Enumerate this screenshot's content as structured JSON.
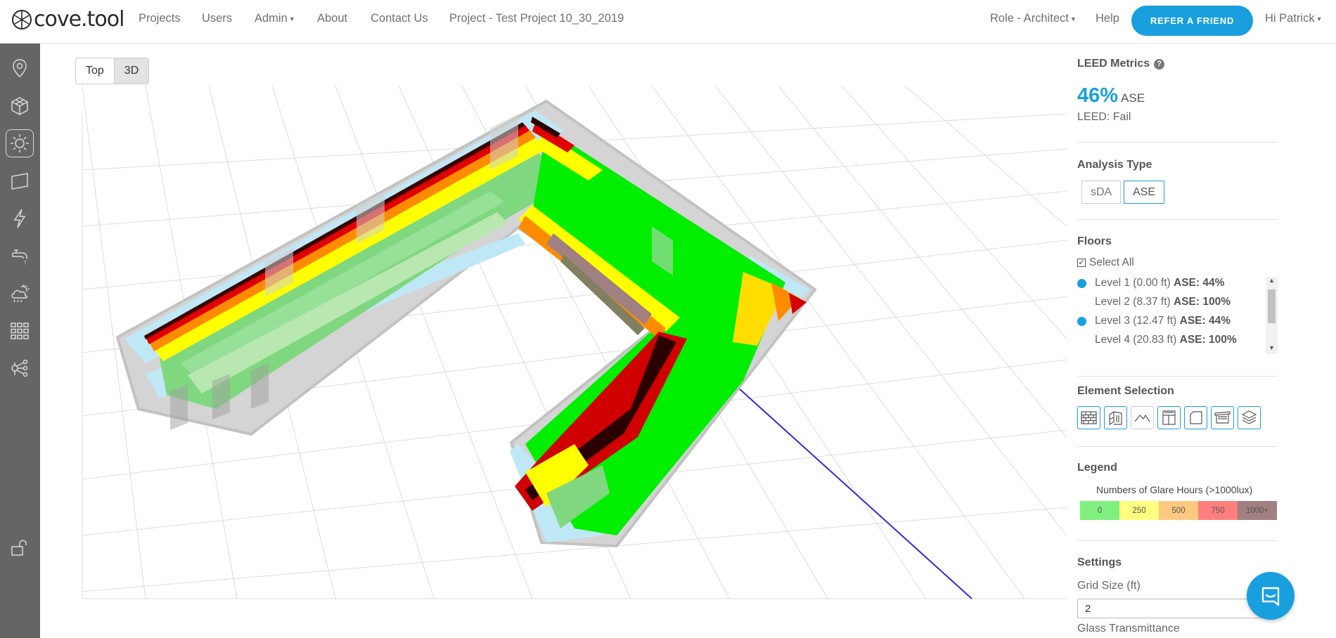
{
  "nav": {
    "logo_text": "cove.tool",
    "links": [
      "Projects",
      "Users",
      "Admin",
      "About",
      "Contact Us",
      "Project - Test Project 10_30_2019"
    ],
    "role": "Role - Architect",
    "help": "Help",
    "refer": "REFER A FRIEND",
    "user": "Hi Patrick"
  },
  "sidebar": {
    "icons": [
      "location-icon",
      "cube-icon",
      "sun-icon",
      "floor-plan-icon",
      "lightning-icon",
      "faucet-icon",
      "weather-icon",
      "grid-icon",
      "network-icon",
      "unlock-icon"
    ],
    "active": "sun-icon"
  },
  "viewport": {
    "view_top": "Top",
    "view_3d": "3D",
    "active_view": "3D"
  },
  "panel": {
    "leed_title": "LEED Metrics",
    "leed_pct": "46%",
    "leed_unit": "ASE",
    "leed_status": "LEED: Fail",
    "analysis_title": "Analysis Type",
    "analysis_options": [
      "sDA",
      "ASE"
    ],
    "analysis_selected": "ASE",
    "floors_title": "Floors",
    "select_all": "Select All",
    "floors": [
      {
        "name": "Level 1 (0.00 ft)",
        "ase": "ASE: 44%",
        "selected": true
      },
      {
        "name": "Level 2 (8.37 ft)",
        "ase": "ASE: 100%",
        "selected": false
      },
      {
        "name": "Level 3 (12.47 ft)",
        "ase": "ASE: 44%",
        "selected": true
      },
      {
        "name": "Level 4 (20.83 ft)",
        "ase": "ASE: 100%",
        "selected": false
      }
    ],
    "element_title": "Element Selection",
    "element_icons": [
      "brick-wall-icon",
      "glazing-icon",
      "roof-icon",
      "window-icon",
      "floor-icon",
      "shade-icon",
      "layers-icon"
    ],
    "legend_title": "Legend",
    "legend_caption": "Numbers of Glare Hours (>1000lux)",
    "legend_items": [
      {
        "label": "0",
        "color": "#7ff07f"
      },
      {
        "label": "250",
        "color": "#ffff80"
      },
      {
        "label": "500",
        "color": "#ffc880"
      },
      {
        "label": "750",
        "color": "#ff7f7f"
      },
      {
        "label": "1000+",
        "color": "#a08080"
      }
    ],
    "settings_title": "Settings",
    "grid_size_label": "Grid Size (ft)",
    "grid_size_value": "2",
    "glass_label": "Glass Transmittance"
  },
  "colors": {
    "accent": "#1a9fde",
    "sidebar_bg": "#656565"
  }
}
